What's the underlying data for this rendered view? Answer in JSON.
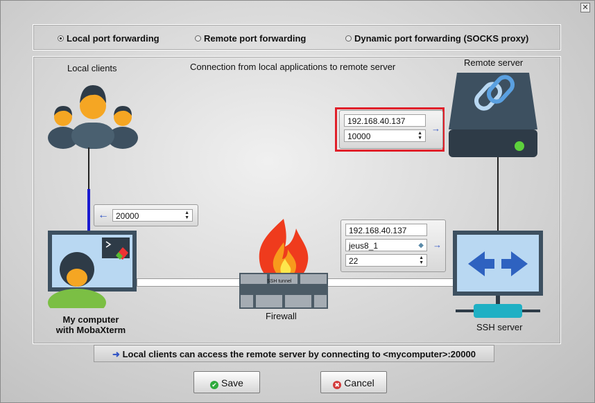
{
  "window": {
    "close_glyph": "✕"
  },
  "modes": [
    {
      "label": "Local port forwarding",
      "selected": true
    },
    {
      "label": "Remote port forwarding",
      "selected": false
    },
    {
      "label": "Dynamic port forwarding (SOCKS proxy)",
      "selected": false
    }
  ],
  "diagram": {
    "local_clients_label": "Local clients",
    "caption": "Connection from local applications to remote server",
    "remote_server_label": "Remote server",
    "my_computer_line1": "My computer",
    "my_computer_line2": "with MobaXterm",
    "firewall_label": "Firewall",
    "ssh_server_label": "SSH server",
    "tunnel_label": "SSH tunnel"
  },
  "fields": {
    "remote_host": "192.168.40.137",
    "remote_port": "10000",
    "local_port": "20000",
    "ssh_host": "192.168.40.137",
    "ssh_user": "jeus8_1",
    "ssh_port": "22"
  },
  "status_text": "Local clients can access the remote server by connecting to <mycomputer>:20000",
  "buttons": {
    "save": "Save",
    "cancel": "Cancel"
  },
  "colors": {
    "highlight": "#e0202a",
    "arrow": "#3457c5",
    "save_icon": "#2eaa3c",
    "cancel_icon": "#d33a3a"
  }
}
